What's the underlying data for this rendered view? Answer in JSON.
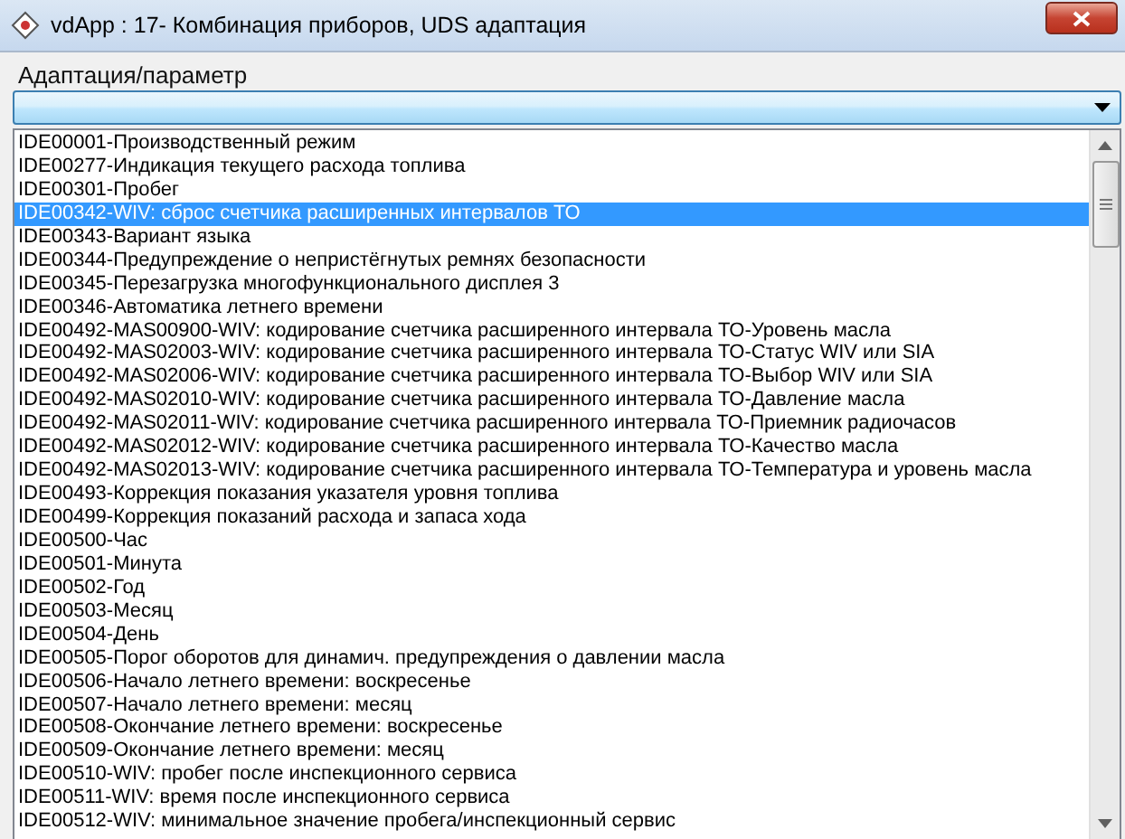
{
  "window": {
    "title": "vdApp : 17- Комбинация приборов,  UDS адаптация"
  },
  "group": {
    "label": "Адаптация/параметр"
  },
  "list": {
    "items": [
      {
        "text": "IDE00001-Производственный режим",
        "selected": false
      },
      {
        "text": "IDE00277-Индикация текущего расхода топлива",
        "selected": false
      },
      {
        "text": "IDE00301-Пробег",
        "selected": false
      },
      {
        "text": "IDE00342-WIV: сброс счетчика расширенных интервалов ТО",
        "selected": true
      },
      {
        "text": "IDE00343-Вариант языка",
        "selected": false
      },
      {
        "text": "IDE00344-Предупреждение о непристёгнутых ремнях безопасности",
        "selected": false
      },
      {
        "text": "IDE00345-Перезагрузка многофункционального дисплея 3",
        "selected": false
      },
      {
        "text": "IDE00346-Автоматика летнего времени",
        "selected": false
      },
      {
        "text": "IDE00492-MAS00900-WIV: кодирование счетчика расширенного интервала ТО-Уровень масла",
        "selected": false
      },
      {
        "text": "IDE00492-MAS02003-WIV: кодирование счетчика расширенного интервала ТО-Статус WIV или SIA",
        "selected": false
      },
      {
        "text": "IDE00492-MAS02006-WIV: кодирование счетчика расширенного интервала ТО-Выбор WIV или SIA",
        "selected": false
      },
      {
        "text": "IDE00492-MAS02010-WIV: кодирование счетчика расширенного интервала ТО-Давление масла",
        "selected": false
      },
      {
        "text": "IDE00492-MAS02011-WIV: кодирование счетчика расширенного интервала ТО-Приемник радиочасов",
        "selected": false
      },
      {
        "text": "IDE00492-MAS02012-WIV: кодирование счетчика расширенного интервала ТО-Качество масла",
        "selected": false
      },
      {
        "text": "IDE00492-MAS02013-WIV: кодирование счетчика расширенного интервала ТО-Температура и уровень масла",
        "selected": false
      },
      {
        "text": "IDE00493-Коррекция показания указателя уровня топлива",
        "selected": false
      },
      {
        "text": "IDE00499-Коррекция показаний расхода и запаса хода",
        "selected": false
      },
      {
        "text": "IDE00500-Час",
        "selected": false
      },
      {
        "text": "IDE00501-Минута",
        "selected": false
      },
      {
        "text": "IDE00502-Год",
        "selected": false
      },
      {
        "text": "IDE00503-Месяц",
        "selected": false
      },
      {
        "text": "IDE00504-День",
        "selected": false
      },
      {
        "text": "IDE00505-Порог оборотов для динамич. предупреждения о давлении масла",
        "selected": false
      },
      {
        "text": "IDE00506-Начало летнего времени: воскресенье",
        "selected": false
      },
      {
        "text": "IDE00507-Начало летнего времени: месяц",
        "selected": false
      },
      {
        "text": "IDE00508-Окончание летнего времени: воскресенье",
        "selected": false
      },
      {
        "text": "IDE00509-Окончание летнего времени: месяц",
        "selected": false
      },
      {
        "text": "IDE00510-WIV: пробег после инспекционного сервиса",
        "selected": false
      },
      {
        "text": "IDE00511-WIV: время после инспекционного сервиса",
        "selected": false
      },
      {
        "text": "IDE00512-WIV: минимальное значение пробега/инспекционный сервис",
        "selected": false
      }
    ]
  }
}
